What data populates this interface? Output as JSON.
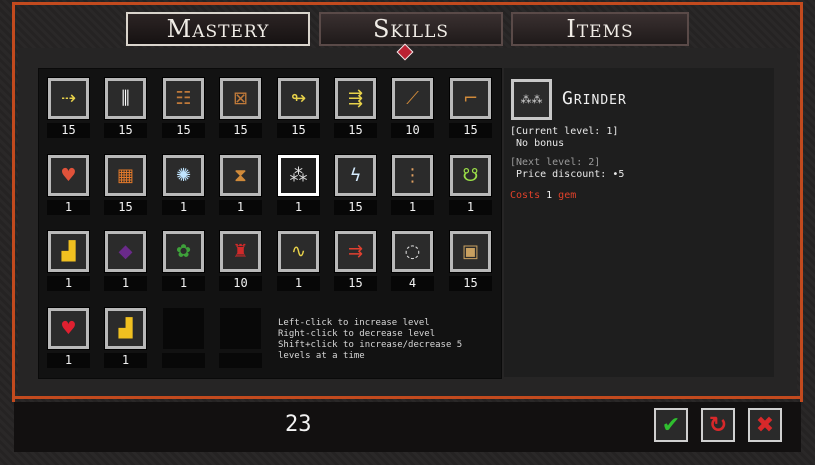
{
  "tabs": [
    {
      "label": "Mastery",
      "active": true
    },
    {
      "label": "Skills",
      "active": false
    },
    {
      "label": "Items",
      "active": false
    }
  ],
  "grid": {
    "rows": [
      [
        {
          "icon": "dash-arrows-icon",
          "count": "15"
        },
        {
          "icon": "triple-bars-icon",
          "count": "15"
        },
        {
          "icon": "ladder-icon",
          "count": "15"
        },
        {
          "icon": "crate-icon",
          "count": "15"
        },
        {
          "icon": "arrow-spiral-icon",
          "count": "15"
        },
        {
          "icon": "multi-arrow-icon",
          "count": "15"
        },
        {
          "icon": "staircase-icon",
          "count": "10"
        },
        {
          "icon": "boot-icon",
          "count": "15"
        }
      ],
      [
        {
          "icon": "heart-gem-icon",
          "count": "1"
        },
        {
          "icon": "fire-grid-icon",
          "count": "15"
        },
        {
          "icon": "ice-burst-icon",
          "count": "1"
        },
        {
          "icon": "totem-icon",
          "count": "1"
        },
        {
          "icon": "grinder-icon",
          "count": "1",
          "selected": true
        },
        {
          "icon": "lightning-figure-icon",
          "count": "15"
        },
        {
          "icon": "rack-icon",
          "count": "1"
        },
        {
          "icon": "demon-mask-icon",
          "count": "1"
        }
      ],
      [
        {
          "icon": "gold-stacks-icon",
          "count": "1"
        },
        {
          "icon": "dark-orb-icon",
          "count": "1"
        },
        {
          "icon": "frog-icon",
          "count": "1"
        },
        {
          "icon": "red-figure-icon",
          "count": "10"
        },
        {
          "icon": "whip-icon",
          "count": "1"
        },
        {
          "icon": "fire-arrows-icon",
          "count": "15"
        },
        {
          "icon": "ring-icon",
          "count": "4"
        },
        {
          "icon": "chest-icon",
          "count": "15"
        }
      ],
      [
        {
          "icon": "heart-icon",
          "count": "1"
        },
        {
          "icon": "gold-stacks-icon",
          "count": "1"
        },
        {
          "icon": "",
          "count": "",
          "empty": true
        },
        {
          "icon": "",
          "count": "",
          "empty": true
        }
      ]
    ]
  },
  "help_text": "Left-click to increase level\nRight-click to decrease level\nShift+click to increase/decrease 5\nlevels at a time",
  "detail": {
    "title": "Grinder",
    "current_level": "[Current level: 1]",
    "current_bonus": " No bonus",
    "next_level": "[Next level: 2]",
    "next_bonus": " Price discount: •5",
    "cost_prefix": "Costs ",
    "cost_amount": "1",
    "cost_suffix": " gem"
  },
  "points": "23",
  "buttons": {
    "confirm_symbol": "✔",
    "reset_symbol": "↻",
    "cancel_symbol": "✖"
  },
  "colors": {
    "accent_orange": "#c24a1e",
    "confirm_green": "#2fbf2f",
    "reset_red": "#d8282a",
    "cancel_red": "#d8282a"
  }
}
